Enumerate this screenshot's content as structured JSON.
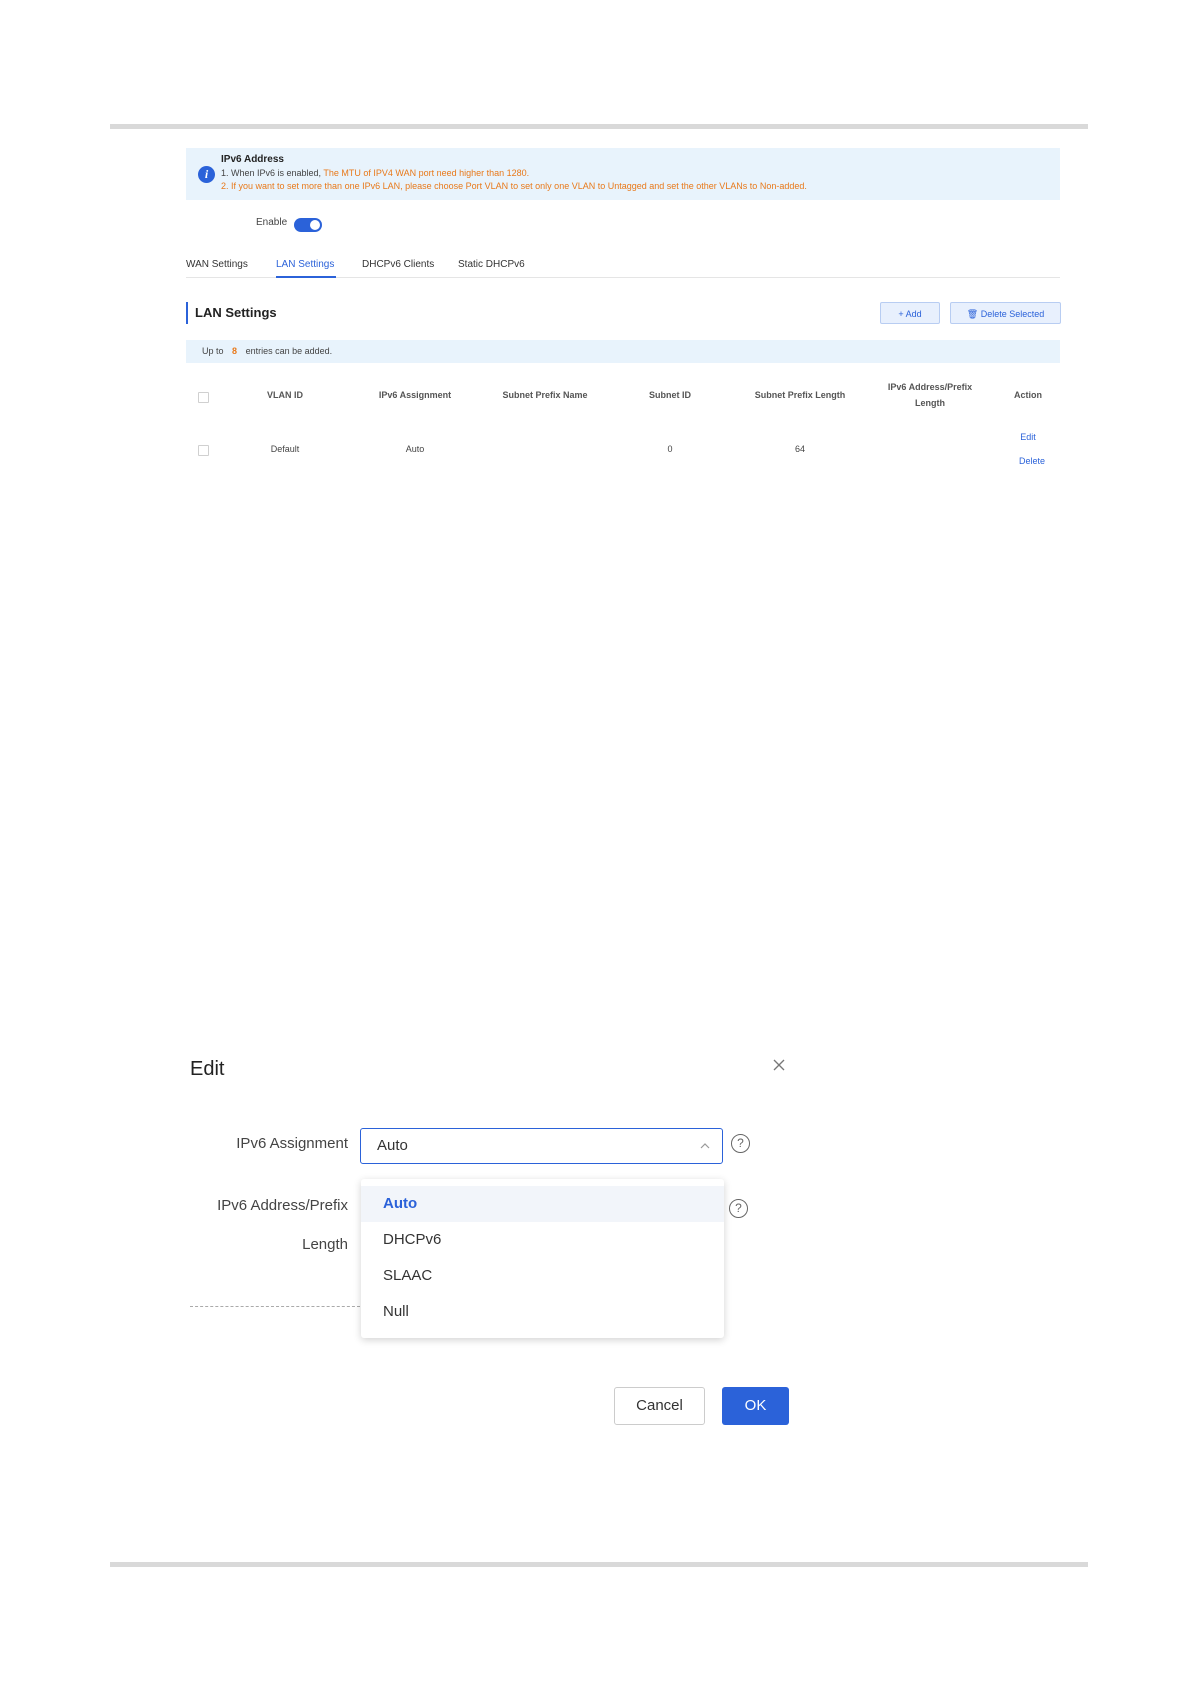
{
  "banner": {
    "title": "IPv6 Address",
    "line1_prefix": "1. When IPv6 is enabled, ",
    "line1_highlight": "The MTU of IPV4 WAN port need higher than 1280.",
    "line2": "2. If you want to set more than one IPv6 LAN, please choose Port VLAN to set only one VLAN to Untagged and set the other VLANs to Non-added."
  },
  "enable": {
    "label": "Enable",
    "state": true
  },
  "tabs": [
    {
      "label": "WAN Settings",
      "active": false
    },
    {
      "label": "LAN Settings",
      "active": true
    },
    {
      "label": "DHCPv6 Clients",
      "active": false
    },
    {
      "label": "Static DHCPv6",
      "active": false
    }
  ],
  "section": {
    "title": "LAN Settings",
    "add_label": "+ Add",
    "delete_label": "🗑 Delete Selected",
    "limit_prefix": "Up to",
    "limit_value": "8",
    "limit_suffix": "entries can be added."
  },
  "table": {
    "headers": [
      "VLAN ID",
      "IPv6 Assignment",
      "Subnet Prefix Name",
      "Subnet ID",
      "Subnet Prefix Length",
      "IPv6 Address/Prefix",
      "Length",
      "Action"
    ],
    "rows": [
      {
        "vlan_id": "Default",
        "assignment": "Auto",
        "prefix_name": "",
        "subnet_id": "0",
        "prefix_length": "64",
        "address": "",
        "edit": "Edit",
        "delete": "Delete"
      }
    ]
  },
  "dialog": {
    "title": "Edit",
    "assignment_label": "IPv6 Assignment",
    "assignment_value": "Auto",
    "address_label_1": "IPv6 Address/Prefix",
    "address_label_2": "Length",
    "options": [
      "Auto",
      "DHCPv6",
      "SLAAC",
      "Null"
    ],
    "selected_option": "Auto",
    "cancel": "Cancel",
    "ok": "OK"
  },
  "colors": {
    "accent": "#2b62d9",
    "warning": "#e8791a",
    "banner_bg": "#e8f3fc"
  }
}
